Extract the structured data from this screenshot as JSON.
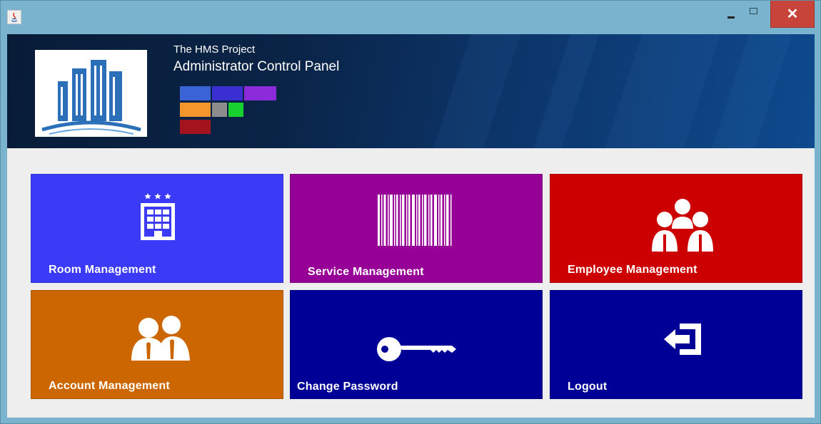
{
  "window": {
    "controls": {
      "minimize": "minimize",
      "maximize": "maximize",
      "close": "✕"
    }
  },
  "header": {
    "subtitle": "The HMS Project",
    "title": "Administrator Control Panel",
    "swatches": [
      "#3a63d6",
      "#3c2fd2",
      "#8b2bd9",
      "#f4962c",
      "#8d8d8d",
      "#19d12e",
      "#a3141e"
    ]
  },
  "tiles": [
    {
      "label": "Room Management",
      "color": "#3a3af7",
      "icon": "hotel-building-icon"
    },
    {
      "label": "Service Management",
      "color": "#960096",
      "icon": "barcode-icon"
    },
    {
      "label": "Employee Management",
      "color": "#cc0000",
      "icon": "employees-group-icon"
    },
    {
      "label": "Account Management",
      "color": "#cc6600",
      "icon": "account-users-icon"
    },
    {
      "label": "Change Password",
      "color": "#000096",
      "icon": "key-icon"
    },
    {
      "label": "Logout",
      "color": "#000096",
      "icon": "logout-icon"
    }
  ]
}
